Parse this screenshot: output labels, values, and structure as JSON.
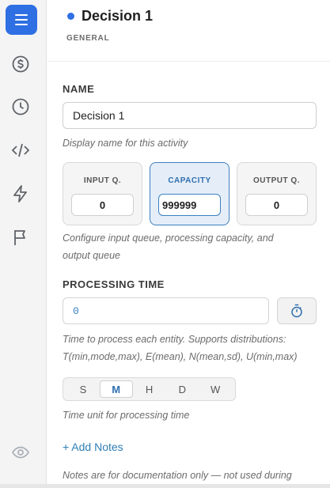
{
  "header": {
    "title": "Decision 1",
    "subtitle": "GENERAL",
    "status_color": "#2f6fe4"
  },
  "sidebar": {
    "items": [
      {
        "icon": "menu-icon",
        "active": true
      },
      {
        "icon": "dollar-icon"
      },
      {
        "icon": "clock-icon"
      },
      {
        "icon": "code-icon"
      },
      {
        "icon": "lightning-icon"
      },
      {
        "icon": "flag-icon"
      },
      {
        "icon": "eye-icon"
      }
    ]
  },
  "name_section": {
    "label": "NAME",
    "value": "Decision 1",
    "help": "Display name for this activity"
  },
  "queues": {
    "input": {
      "label": "INPUT Q.",
      "value": "0"
    },
    "capacity": {
      "label": "CAPACITY",
      "value": "999999"
    },
    "output": {
      "label": "OUTPUT Q.",
      "value": "0"
    },
    "help_line1": "Configure input queue, processing capacity, and",
    "help_line2": "output queue"
  },
  "processing_time": {
    "label": "PROCESSING TIME",
    "value": "0",
    "help_line1": "Time to process each entity. Supports distributions:",
    "help_line2": "T(min,mode,max), E(mean), N(mean,sd), U(min,max)"
  },
  "time_units": {
    "options": [
      "S",
      "M",
      "H",
      "D",
      "W"
    ],
    "selected": "M",
    "help": "Time unit for processing time"
  },
  "notes": {
    "add_label": "+ Add Notes",
    "help": "Notes are for documentation only — not used during"
  },
  "colors": {
    "accent": "#2f6fe4",
    "link": "#2f7fb8"
  }
}
